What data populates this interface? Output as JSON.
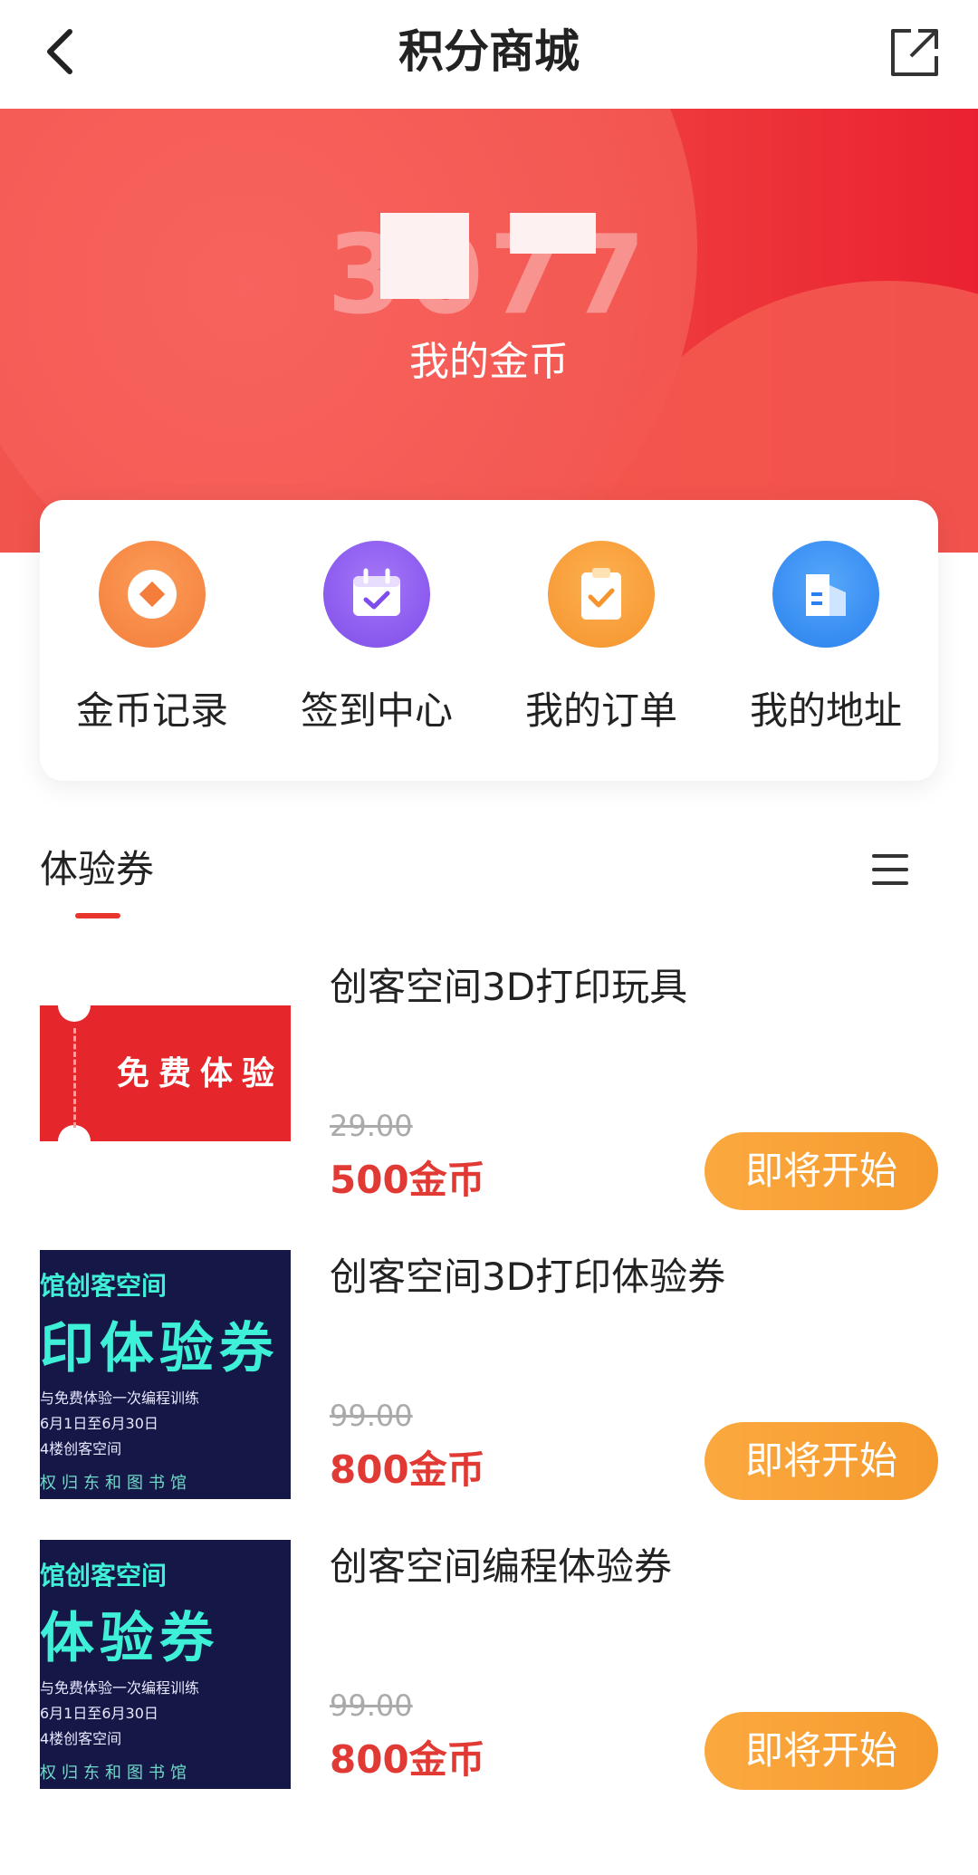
{
  "header": {
    "title": "积分商城",
    "back_icon": "chevron-left-icon",
    "share_icon": "external-link-icon"
  },
  "hero": {
    "coin_amount": "3077",
    "coin_label": "我的金币"
  },
  "actions": [
    {
      "label": "金币记录",
      "icon": "coin-icon",
      "color": "#f7873f"
    },
    {
      "label": "签到中心",
      "icon": "calendar-check-icon",
      "color": "#8b5cf2"
    },
    {
      "label": "我的订单",
      "icon": "clipboard-check-icon",
      "color": "#f8962f"
    },
    {
      "label": "我的地址",
      "icon": "building-icon",
      "color": "#2f8ef4"
    }
  ],
  "section": {
    "title": "体验券",
    "menu_icon": "menu-icon"
  },
  "products": [
    {
      "name": "创客空间3D打印玩具",
      "original_price": "29.00",
      "price": "500金币",
      "button": "即将开始",
      "thumb": {
        "text": "免费体验"
      }
    },
    {
      "name": "创客空间3D打印体验券",
      "original_price": "99.00",
      "price": "800金币",
      "button": "即将开始",
      "thumb": {
        "line1": "馆创客空间",
        "line2": "印体验券",
        "line3": "与免费体验一次编程训练",
        "line4": "6月1日至6月30日",
        "line5": "4楼创客空间",
        "line6": "权归东和图书馆"
      }
    },
    {
      "name": "创客空间编程体验券",
      "original_price": "99.00",
      "price": "800金币",
      "button": "即将开始",
      "thumb": {
        "line1": "馆创客空间",
        "line2": "体验券",
        "line3": "与免费体验一次编程训练",
        "line4": "6月1日至6月30日",
        "line5": "4楼创客空间",
        "line6": "权归东和图书馆"
      }
    }
  ],
  "colors": {
    "accent_red": "#e13a34",
    "button_orange": "#fba93f",
    "hero_red": "#f04440"
  }
}
